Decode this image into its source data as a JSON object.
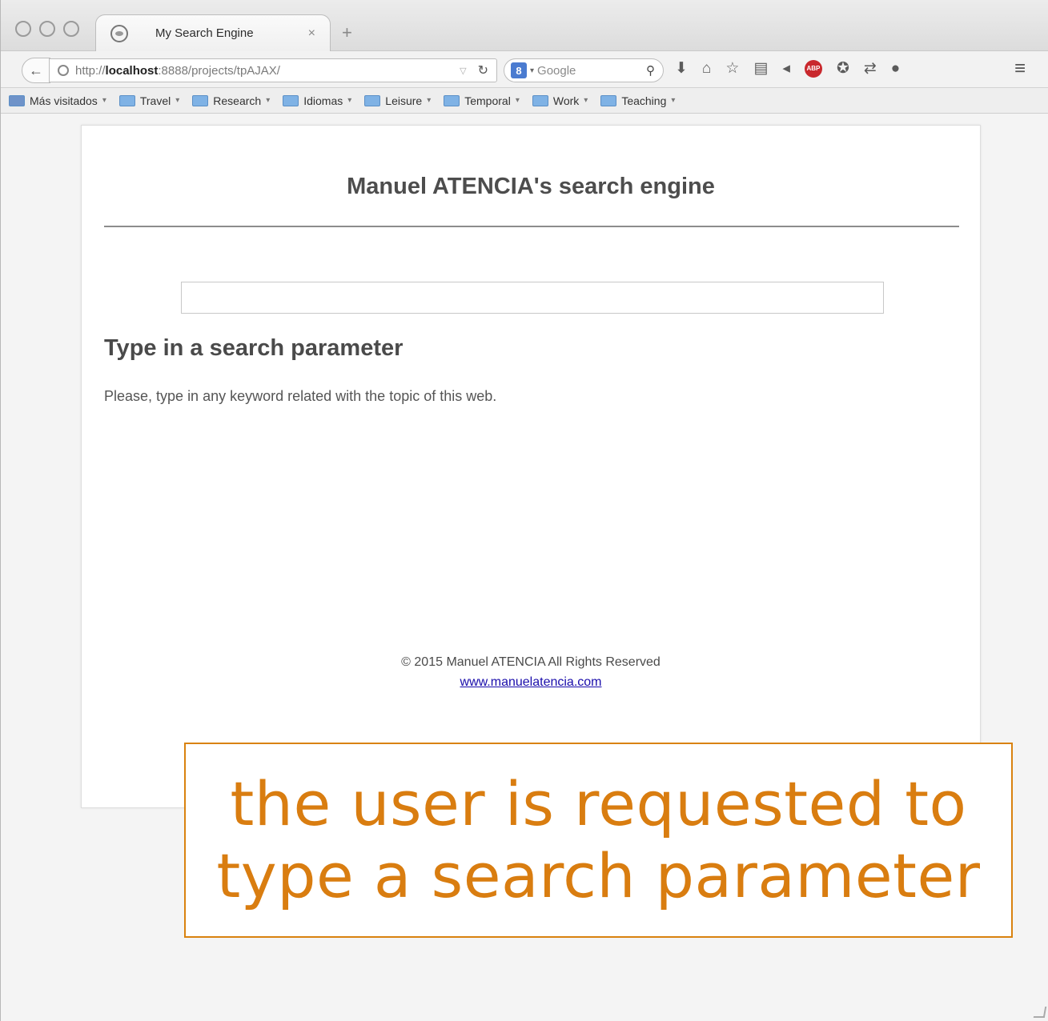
{
  "browser": {
    "tab_title": "My Search Engine",
    "tab_close": "×",
    "new_tab": "+",
    "url_prefix": "http://",
    "url_host": "localhost",
    "url_rest": ":8888/projects/tpAJAX/",
    "search_engine_label": "Google",
    "search_engine_letter": "8",
    "bookmarks": [
      {
        "label": "Más visitados",
        "caret": "▾"
      },
      {
        "label": "Travel",
        "caret": "▾"
      },
      {
        "label": "Research",
        "caret": "▾"
      },
      {
        "label": "Idiomas",
        "caret": "▾"
      },
      {
        "label": "Leisure",
        "caret": "▾"
      },
      {
        "label": "Temporal",
        "caret": "▾"
      },
      {
        "label": "Work",
        "caret": "▾"
      },
      {
        "label": "Teaching",
        "caret": "▾"
      }
    ]
  },
  "page": {
    "title": "Manuel ATENCIA's search engine",
    "search_value": "",
    "heading": "Type in a search parameter",
    "instruction": "Please, type in any keyword related with the topic of this web.",
    "footer_copyright": "© 2015 Manuel ATENCIA All Rights Reserved",
    "footer_link": "www.manuelatencia.com"
  },
  "annotation": {
    "line1": "the user is requested to",
    "line2": "type a search parameter"
  },
  "colors": {
    "annotation": "#d97d10",
    "link": "#1a0dab"
  }
}
